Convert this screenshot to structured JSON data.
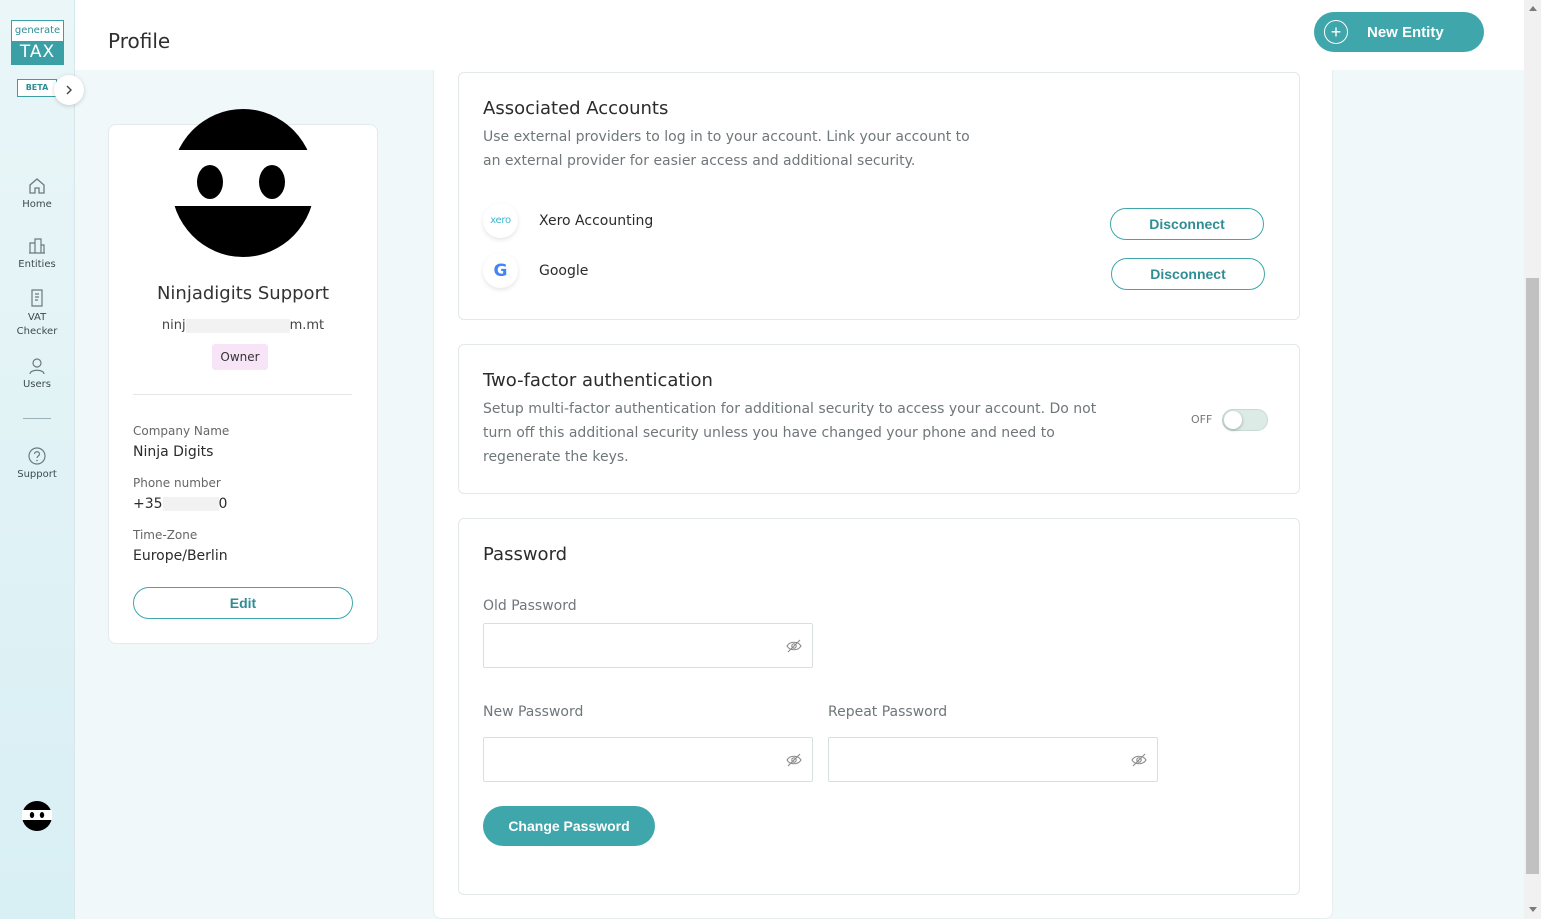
{
  "brand": {
    "logo_top": "generate",
    "logo_bottom": "TAX",
    "beta": "BETA",
    "accent": "#3fa6ab"
  },
  "sidebar": {
    "items": [
      {
        "label": "Home",
        "icon": "home-icon"
      },
      {
        "label": "Entities",
        "icon": "buildings-icon"
      },
      {
        "label": "VAT\nChecker",
        "icon": "document-icon"
      },
      {
        "label": "Users",
        "icon": "user-icon"
      },
      {
        "label": "Support",
        "icon": "help-icon"
      }
    ]
  },
  "header": {
    "title": "Profile",
    "new_entity_label": "New Entity"
  },
  "profile": {
    "name": "Ninjadigits Support",
    "email_start": "ninj",
    "email_end": "m.mt",
    "role": "Owner",
    "company_label": "Company Name",
    "company": "Ninja Digits",
    "phone_label": "Phone number",
    "phone_start": "+35",
    "phone_end": "0",
    "timezone_label": "Time-Zone",
    "timezone": "Europe/Berlin",
    "edit_label": "Edit"
  },
  "accounts": {
    "title": "Associated Accounts",
    "description_line1": "Use external providers to log in to your account. Link your account to",
    "description_line2": "an external provider for easier access and additional security.",
    "items": [
      {
        "logo": "xero",
        "name": "Xero Accounting",
        "action": "Disconnect"
      },
      {
        "logo": "G",
        "name": "Google",
        "action": "Disconnect"
      }
    ]
  },
  "twofa": {
    "title": "Two-factor authentication",
    "description_line1": "Setup multi-factor authentication for additional security to access your account. Do not",
    "description_line2": "turn off this additional security unless you have changed your phone and need to",
    "description_line3": "regenerate the keys.",
    "toggle_state": "OFF"
  },
  "password": {
    "title": "Password",
    "old_label": "Old Password",
    "new_label": "New Password",
    "repeat_label": "Repeat Password",
    "old_value": "",
    "new_value": "",
    "repeat_value": "",
    "submit_label": "Change Password"
  }
}
